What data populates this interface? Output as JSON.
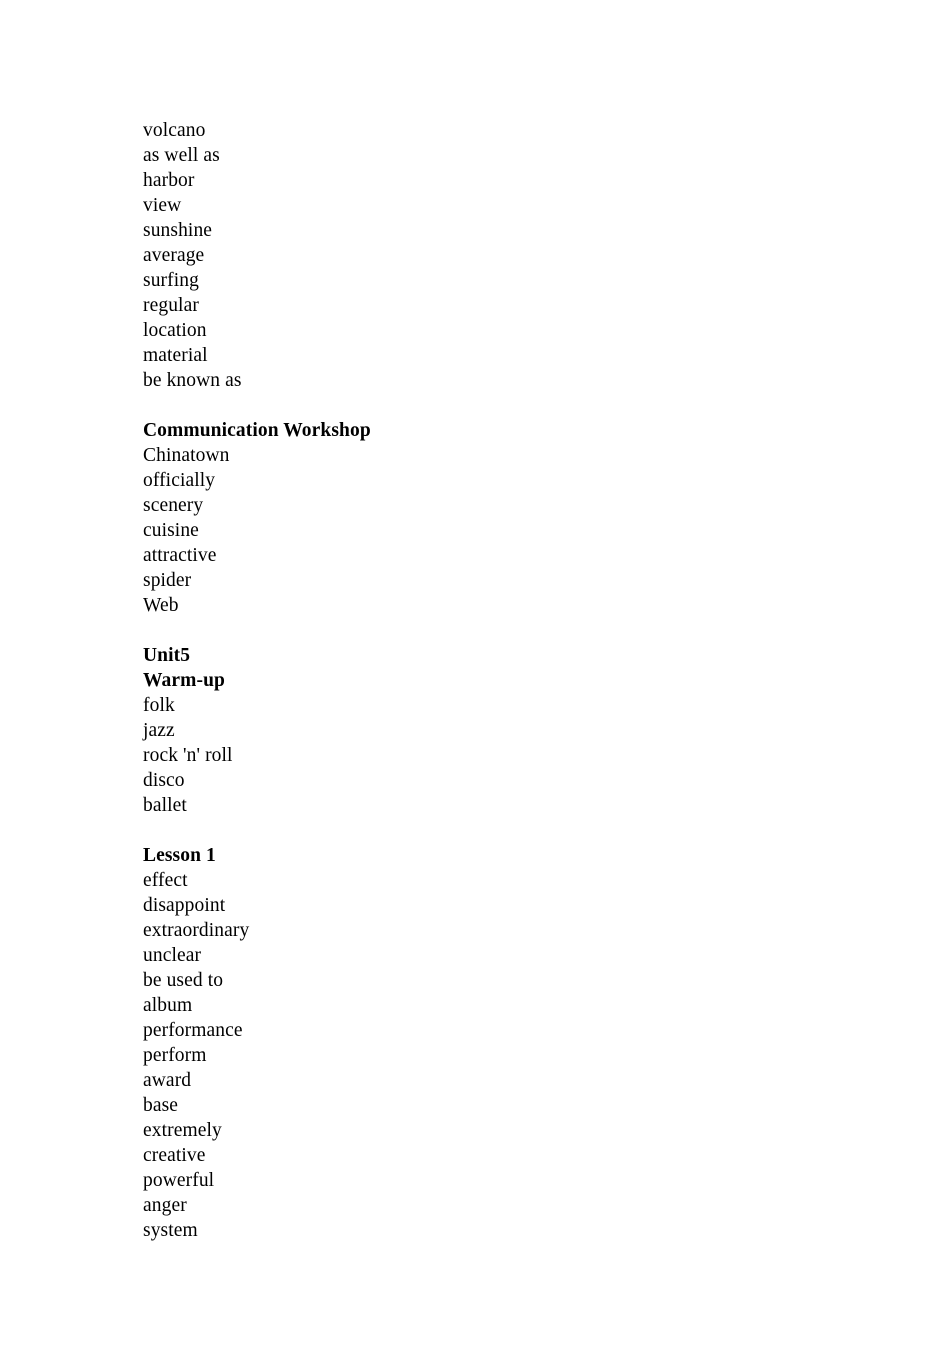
{
  "document": {
    "type": "vocabulary-word-list",
    "page_background": "#ffffff",
    "text_color": "#000000",
    "blocks": [
      {
        "id": "block-1",
        "heading": null,
        "lines": [
          {
            "text": "volcano",
            "bold": false
          },
          {
            "text": "as well as",
            "bold": false
          },
          {
            "text": "harbor",
            "bold": false
          },
          {
            "text": "view",
            "bold": false
          },
          {
            "text": "sunshine",
            "bold": false
          },
          {
            "text": "average",
            "bold": false
          },
          {
            "text": "surfing",
            "bold": false
          },
          {
            "text": "regular",
            "bold": false
          },
          {
            "text": "location",
            "bold": false
          },
          {
            "text": "material",
            "bold": false
          },
          {
            "text": "be known as",
            "bold": false
          }
        ]
      },
      {
        "id": "block-2",
        "heading": "Communication Workshop",
        "lines": [
          {
            "text": "Communication Workshop",
            "bold": true
          },
          {
            "text": "Chinatown",
            "bold": false
          },
          {
            "text": "officially",
            "bold": false
          },
          {
            "text": "scenery",
            "bold": false
          },
          {
            "text": "cuisine",
            "bold": false
          },
          {
            "text": "attractive",
            "bold": false
          },
          {
            "text": "spider",
            "bold": false
          },
          {
            "text": "Web",
            "bold": false
          }
        ]
      },
      {
        "id": "block-3",
        "heading": "Unit5",
        "lines": [
          {
            "text": "Unit5",
            "bold": true
          },
          {
            "text": "Warm-up",
            "bold": true
          },
          {
            "text": "folk",
            "bold": false
          },
          {
            "text": "jazz",
            "bold": false
          },
          {
            "text": "rock 'n' roll",
            "bold": false
          },
          {
            "text": "disco",
            "bold": false
          },
          {
            "text": "ballet",
            "bold": false
          }
        ]
      },
      {
        "id": "block-4",
        "heading": "Lesson 1",
        "lines": [
          {
            "text": "Lesson 1",
            "bold": true
          },
          {
            "text": "effect",
            "bold": false
          },
          {
            "text": "disappoint",
            "bold": false
          },
          {
            "text": "extraordinary",
            "bold": false
          },
          {
            "text": "unclear",
            "bold": false
          },
          {
            "text": "be used to",
            "bold": false
          },
          {
            "text": "album",
            "bold": false
          },
          {
            "text": "performance",
            "bold": false
          },
          {
            "text": "perform",
            "bold": false
          },
          {
            "text": "award",
            "bold": false
          },
          {
            "text": "base",
            "bold": false
          },
          {
            "text": "extremely",
            "bold": false
          },
          {
            "text": "creative",
            "bold": false
          },
          {
            "text": "powerful",
            "bold": false
          },
          {
            "text": "anger",
            "bold": false
          },
          {
            "text": "system",
            "bold": false
          }
        ]
      }
    ]
  }
}
